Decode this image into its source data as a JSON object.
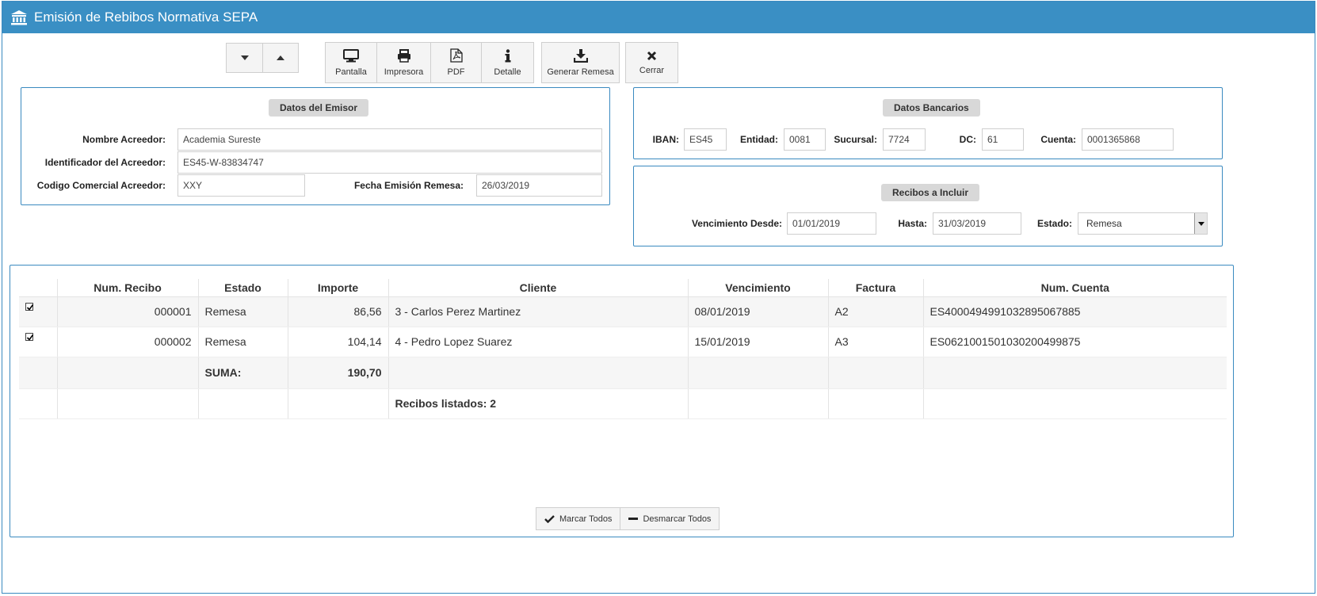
{
  "window": {
    "title": "Emisión de Rebibos Normativa SEPA"
  },
  "toolbar": {
    "pantalla": "Pantalla",
    "impresora": "Impresora",
    "pdf": "PDF",
    "detalle": "Detalle",
    "generar": "Generar Remesa",
    "cerrar": "Cerrar"
  },
  "emisor": {
    "legend": "Datos del Emisor",
    "nombre_label": "Nombre Acreedor:",
    "nombre_value": "Academia Sureste",
    "identificador_label": "Identificador del Acreedor:",
    "identificador_value": "ES45-W-83834747",
    "codigo_label": "Codigo Comercial Acreedor:",
    "codigo_value": "XXY",
    "fecha_label": "Fecha Emisión Remesa:",
    "fecha_value": "26/03/2019"
  },
  "bancarios": {
    "legend": "Datos Bancarios",
    "iban_label": "IBAN:",
    "iban_value": "ES45",
    "entidad_label": "Entidad:",
    "entidad_value": "0081",
    "sucursal_label": "Sucursal:",
    "sucursal_value": "7724",
    "dc_label": "DC:",
    "dc_value": "61",
    "cuenta_label": "Cuenta:",
    "cuenta_value": "0001365868"
  },
  "recibos": {
    "legend": "Recibos a Incluir",
    "desde_label": "Vencimiento Desde:",
    "desde_value": "01/01/2019",
    "hasta_label": "Hasta:",
    "hasta_value": "31/03/2019",
    "estado_label": "Estado:",
    "estado_value": "Remesa"
  },
  "table": {
    "headers": [
      "",
      "Num. Recibo",
      "Estado",
      "Importe",
      "Cliente",
      "Vencimiento",
      "Factura",
      "Num. Cuenta"
    ],
    "rows": [
      {
        "checked": true,
        "num": "000001",
        "estado": "Remesa",
        "importe": "86,56",
        "cliente": "3 - Carlos Perez Martinez",
        "vencimiento": "08/01/2019",
        "factura": "A2",
        "cuenta": "ES4000494991032895067885"
      },
      {
        "checked": true,
        "num": "000002",
        "estado": "Remesa",
        "importe": "104,14",
        "cliente": "4 - Pedro Lopez Suarez",
        "vencimiento": "15/01/2019",
        "factura": "A3",
        "cuenta": "ES0621001501030200499875"
      }
    ],
    "suma_label": "SUMA:",
    "suma_value": "190,70",
    "listados": "Recibos listados: 2"
  },
  "actions": {
    "marcar": "Marcar Todos",
    "desmarcar": "Desmarcar Todos"
  },
  "colors": {
    "accent": "#3a8fc4",
    "border": "#3a8ac0"
  }
}
